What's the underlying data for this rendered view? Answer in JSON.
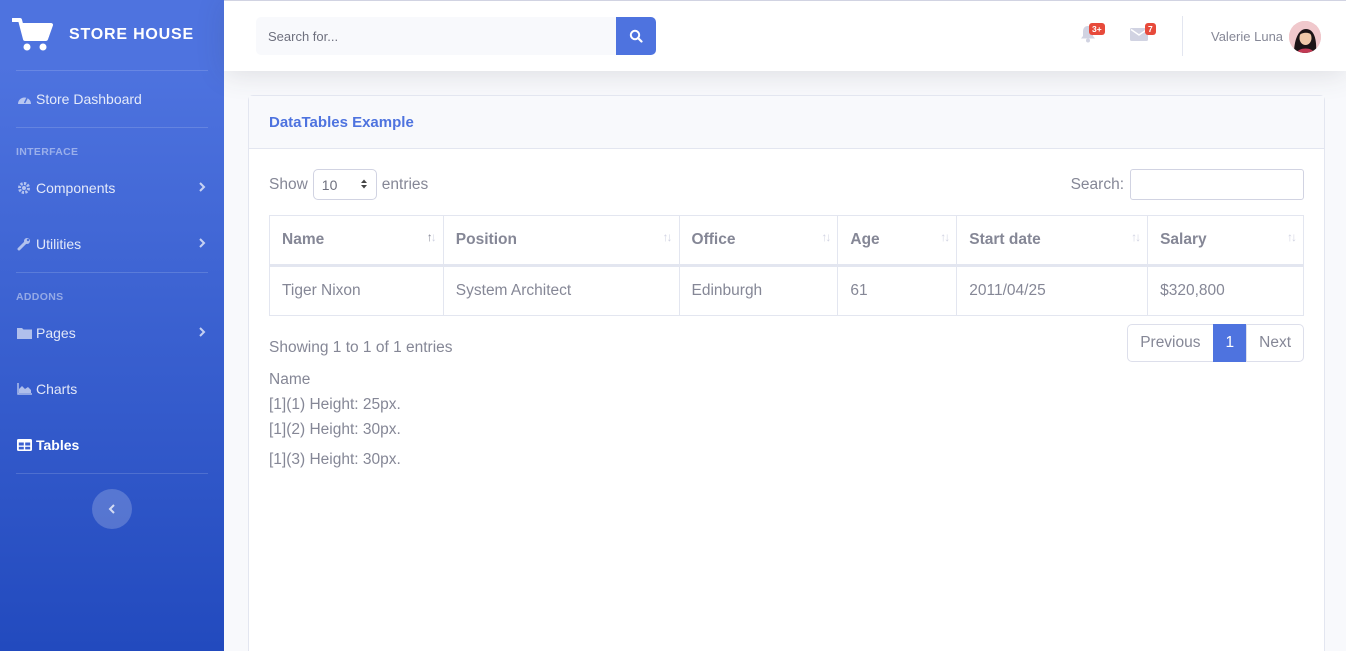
{
  "brand": {
    "name": "STORE HOUSE",
    "icon": "cart-icon"
  },
  "sidebar": {
    "dashboard": {
      "label": "Store Dashboard",
      "icon": "tachometer-icon"
    },
    "heading_interface": "INTERFACE",
    "components": {
      "label": "Components",
      "icon": "gear-icon"
    },
    "utilities": {
      "label": "Utilities",
      "icon": "wrench-icon"
    },
    "heading_addons": "ADDONS",
    "pages": {
      "label": "Pages",
      "icon": "folder-icon"
    },
    "charts": {
      "label": "Charts",
      "icon": "chart-area-icon"
    },
    "tables": {
      "label": "Tables",
      "icon": "table-icon",
      "active": true
    }
  },
  "topbar": {
    "search_placeholder": "Search for...",
    "alerts_badge": "3+",
    "messages_badge": "7",
    "user_name": "Valerie Luna"
  },
  "card": {
    "title": "DataTables Example",
    "show_label": "Show",
    "entries_label": "entries",
    "page_length": "10",
    "search_label": "Search:",
    "columns": [
      "Name",
      "Position",
      "Office",
      "Age",
      "Start date",
      "Salary"
    ],
    "rows": [
      [
        "Tiger Nixon",
        "System Architect",
        "Edinburgh",
        "61",
        "2011/04/25",
        "$320,800"
      ]
    ],
    "info": "Showing 1 to 1 of 1 entries",
    "pagination": {
      "previous": "Previous",
      "current": "1",
      "next": "Next"
    },
    "notes": [
      "Name",
      "[1](1) Height: 25px.",
      "[1](2) Height: 30px.",
      "[1](3) Height: 30px."
    ]
  },
  "colors": {
    "primary": "#4e73df",
    "sidebar_end": "#224abe",
    "badge": "#e74a3b",
    "text": "#858796"
  }
}
